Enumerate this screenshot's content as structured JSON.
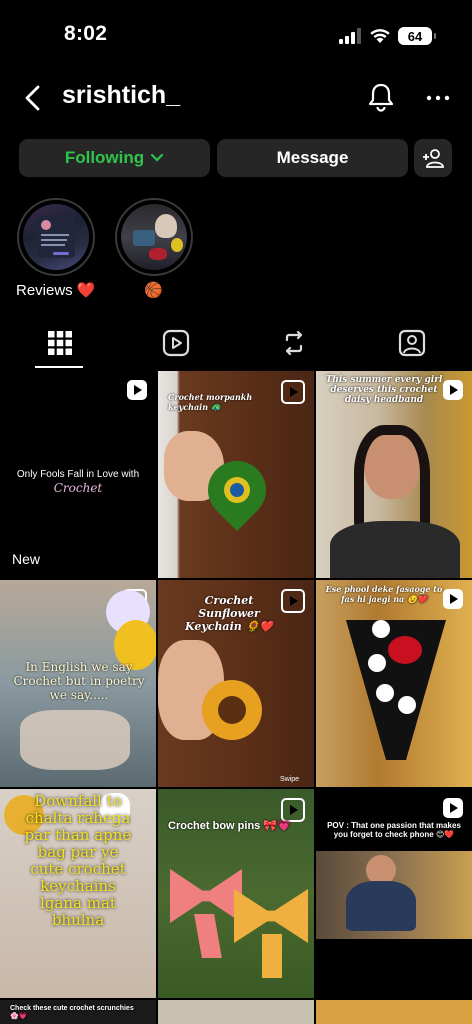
{
  "status_bar": {
    "time": "8:02",
    "battery": "64"
  },
  "header": {
    "username": "srishtich_"
  },
  "actions": {
    "following": "Following",
    "message": "Message"
  },
  "highlights": [
    {
      "label": "Reviews ❤️"
    },
    {
      "label": "🏀"
    }
  ],
  "tabs": [
    "grid",
    "reels",
    "reposts",
    "tagged"
  ],
  "posts": [
    {
      "caption": "Only Fools Fall in Love with",
      "caption2": "Crochet",
      "badge": "New"
    },
    {
      "caption": "Crochet morpankh keychain 🦚"
    },
    {
      "caption": "This summer every girl deserves this crochet daisy headband"
    },
    {
      "caption": "In English we say Crochet but in poetry we say....."
    },
    {
      "caption": "Crochet Sunflower Keychain 🌻❤️",
      "caption2": "Swipe"
    },
    {
      "caption": "Ese phool deke fasaoge to fas hi jaegi na 😉❤️"
    },
    {
      "caption": "Downfall to chalta rahega par than apne bag par ye cute crochet keychains lgana mat bhulna"
    },
    {
      "caption": "Crochet bow pins 🎀💗"
    },
    {
      "caption": "POV : That one passion that makes you forget to check phone 😊❤️"
    },
    {
      "caption": "Check these cute crochet scrunchies 🌸💗"
    }
  ]
}
